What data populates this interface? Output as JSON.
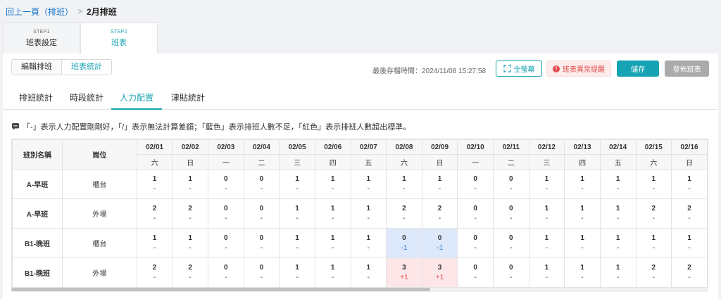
{
  "breadcrumb": {
    "back": "回上一頁（排班）",
    "separator": ">",
    "current": "2月排班"
  },
  "steps": [
    {
      "step": "STEP1",
      "name": "班表設定"
    },
    {
      "step": "STEP2",
      "name": "班表"
    }
  ],
  "segment": {
    "edit": "編輯排班",
    "stats": "班表統計"
  },
  "toolbar": {
    "save_time": "最後存檔時間：2024/11/08 15:27:58",
    "fullscreen": "全螢幕",
    "alert": "班表異常提醒",
    "save": "儲存",
    "publish": "發佈班表"
  },
  "tabs": [
    "排班統計",
    "時段統計",
    "人力配置",
    "津貼統計"
  ],
  "notice": "「-」表示人力配置剛剛好，「/」表示無法計算差額；「藍色」表示排班人數不足，「紅色」表示排班人數超出標準。",
  "table": {
    "header_shift": "班別名稱",
    "header_post": "崗位",
    "dates": [
      "02/01",
      "02/02",
      "02/03",
      "02/04",
      "02/05",
      "02/06",
      "02/07",
      "02/08",
      "02/09",
      "02/10",
      "02/11",
      "02/12",
      "02/13",
      "02/14",
      "02/15",
      "02/16"
    ],
    "weekdays": [
      "六",
      "日",
      "一",
      "二",
      "三",
      "四",
      "五",
      "六",
      "日",
      "一",
      "二",
      "三",
      "四",
      "五",
      "六",
      "日"
    ],
    "rows": [
      {
        "shift": "A-早班",
        "post": "櫃台",
        "counts": [
          "1",
          "1",
          "0",
          "0",
          "1",
          "1",
          "1",
          "1",
          "1",
          "0",
          "0",
          "1",
          "1",
          "1",
          "1",
          "1"
        ],
        "diffs": [
          "-",
          "-",
          "-",
          "-",
          "-",
          "-",
          "-",
          "-",
          "-",
          "-",
          "-",
          "-",
          "-",
          "-",
          "-",
          "-"
        ],
        "status": [
          "",
          "",
          "",
          "",
          "",
          "",
          "",
          "",
          "",
          "",
          "",
          "",
          "",
          "",
          "",
          ""
        ]
      },
      {
        "shift": "A-早班",
        "post": "外場",
        "counts": [
          "2",
          "2",
          "0",
          "0",
          "1",
          "1",
          "1",
          "2",
          "2",
          "0",
          "0",
          "1",
          "1",
          "1",
          "2",
          "2"
        ],
        "diffs": [
          "-",
          "-",
          "-",
          "-",
          "-",
          "-",
          "-",
          "-",
          "-",
          "-",
          "-",
          "-",
          "-",
          "-",
          "-",
          "-"
        ],
        "status": [
          "",
          "",
          "",
          "",
          "",
          "",
          "",
          "",
          "",
          "",
          "",
          "",
          "",
          "",
          "",
          ""
        ]
      },
      {
        "shift": "B1-晚班",
        "post": "櫃台",
        "counts": [
          "1",
          "1",
          "0",
          "0",
          "1",
          "1",
          "1",
          "0",
          "0",
          "0",
          "0",
          "1",
          "1",
          "1",
          "1",
          "1"
        ],
        "diffs": [
          "-",
          "-",
          "-",
          "-",
          "-",
          "-",
          "-",
          "-1",
          "-1",
          "-",
          "-",
          "-",
          "-",
          "-",
          "-",
          "-"
        ],
        "status": [
          "",
          "",
          "",
          "",
          "",
          "",
          "",
          "blue",
          "blue",
          "",
          "",
          "",
          "",
          "",
          "",
          ""
        ]
      },
      {
        "shift": "B1-晚班",
        "post": "外場",
        "counts": [
          "2",
          "2",
          "0",
          "0",
          "1",
          "1",
          "1",
          "3",
          "3",
          "0",
          "0",
          "1",
          "1",
          "1",
          "2",
          "2"
        ],
        "diffs": [
          "-",
          "-",
          "-",
          "-",
          "-",
          "-",
          "-",
          "+1",
          "+1",
          "-",
          "-",
          "-",
          "-",
          "-",
          "-",
          "-"
        ],
        "status": [
          "",
          "",
          "",
          "",
          "",
          "",
          "",
          "red",
          "red",
          "",
          "",
          "",
          "",
          "",
          "",
          ""
        ]
      }
    ]
  },
  "colors": {
    "accent": "#16a3b4",
    "shortage": "#dde9fb",
    "excess": "#fde6e8",
    "alert": "#e24c4c"
  }
}
